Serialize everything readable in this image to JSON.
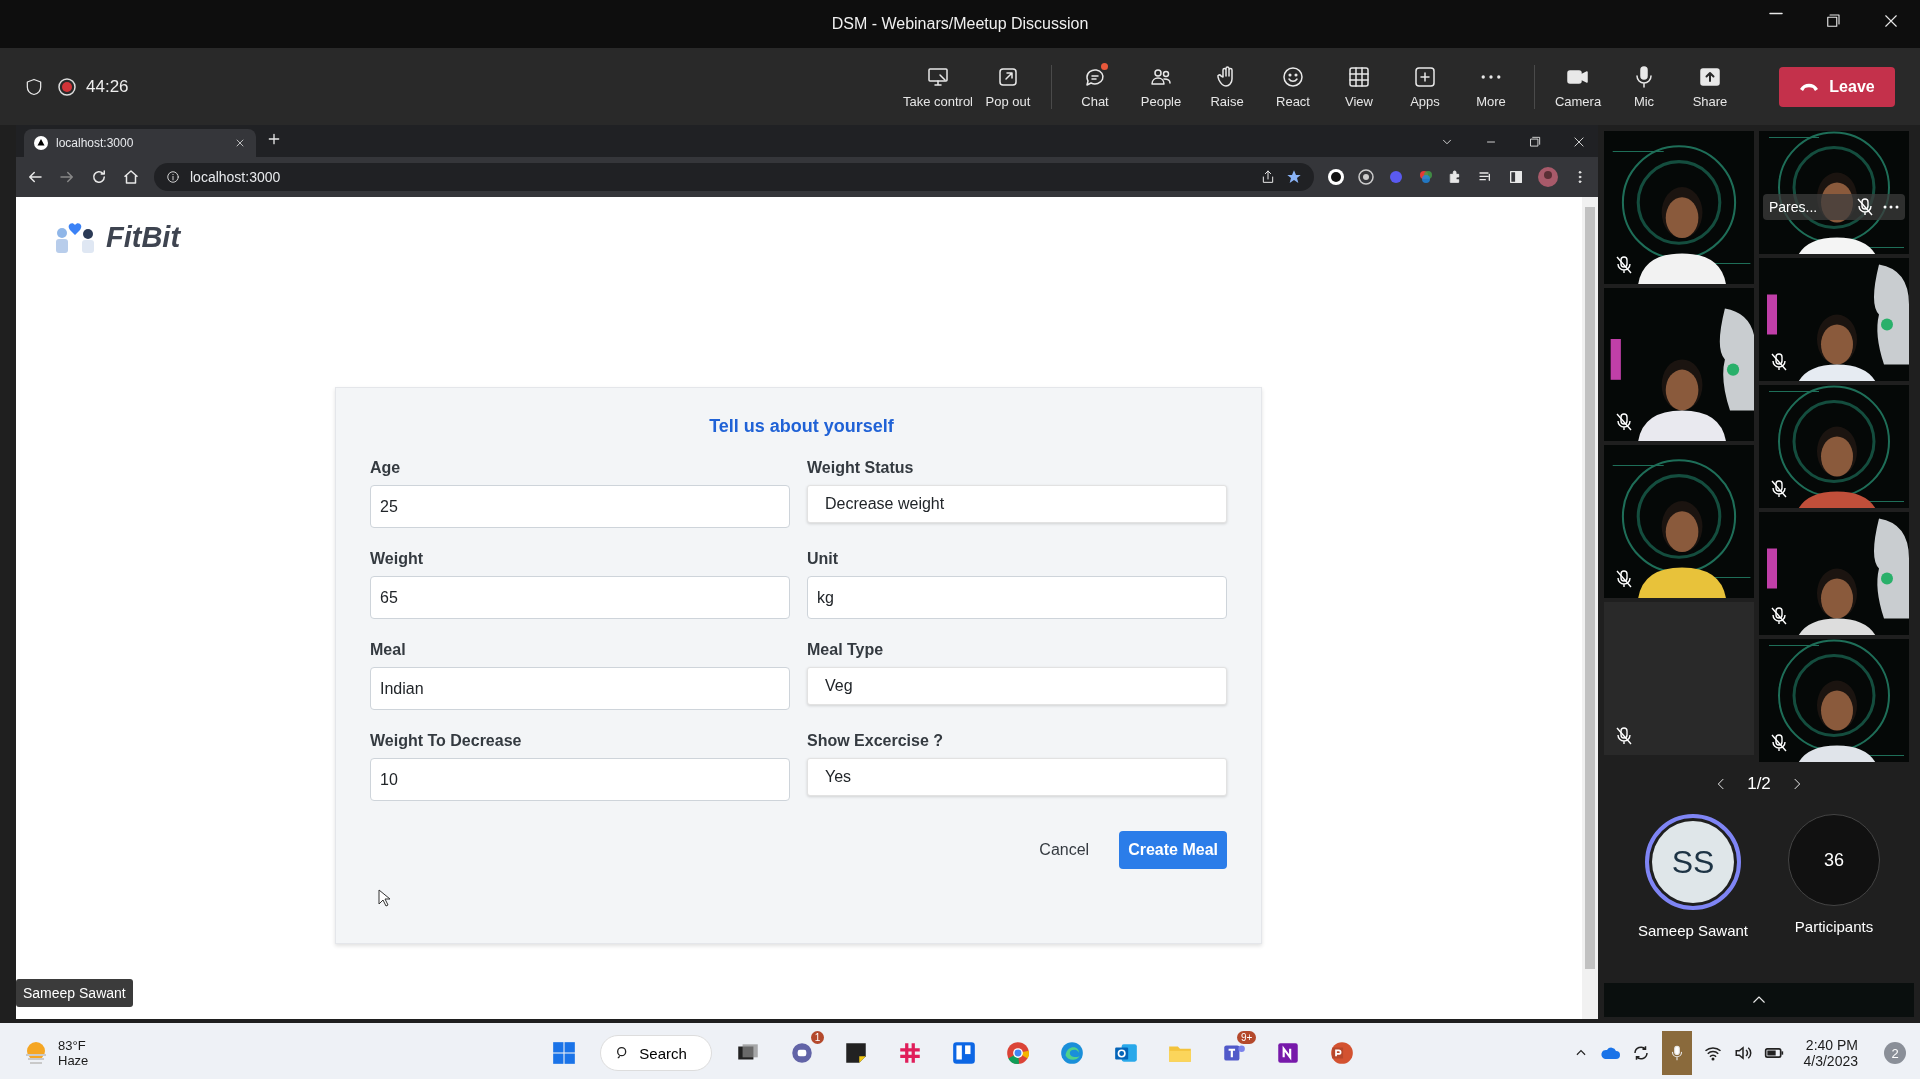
{
  "window": {
    "title": "DSM - Webinars/Meetup Discussion"
  },
  "meeting_bar": {
    "recording": true,
    "timer": "44:26",
    "actions": [
      {
        "label": "Take control",
        "unread": false
      },
      {
        "label": "Pop out",
        "unread": false
      },
      {
        "label": "Chat",
        "unread": true
      },
      {
        "label": "People",
        "unread": false
      },
      {
        "label": "Raise",
        "unread": false
      },
      {
        "label": "React",
        "unread": false
      },
      {
        "label": "View",
        "unread": false
      },
      {
        "label": "Apps",
        "unread": false
      },
      {
        "label": "More",
        "unread": false
      },
      {
        "label": "Camera",
        "unread": false
      },
      {
        "label": "Mic",
        "unread": false
      },
      {
        "label": "Share",
        "unread": false
      }
    ],
    "leave": "Leave"
  },
  "browser": {
    "tab": "localhost:3000",
    "url": "localhost:3000"
  },
  "page": {
    "logo": "FitBit",
    "form": {
      "title": "Tell us about yourself",
      "fields": [
        {
          "label": "Age",
          "value": "25",
          "kind": "input"
        },
        {
          "label": "Weight Status",
          "value": "Decrease weight",
          "kind": "select"
        },
        {
          "label": "Weight",
          "value": "65",
          "kind": "input"
        },
        {
          "label": "Unit",
          "value": "kg",
          "kind": "input"
        },
        {
          "label": "Meal",
          "value": "Indian",
          "kind": "input"
        },
        {
          "label": "Meal Type",
          "value": "Veg",
          "kind": "select"
        },
        {
          "label": "Weight To Decrease",
          "value": "10",
          "kind": "input"
        },
        {
          "label": "Show Excercise ?",
          "value": "Yes",
          "kind": "select"
        }
      ],
      "cancel": "Cancel",
      "submit": "Create Meal"
    }
  },
  "presenter_label": "Sameep Sawant",
  "video_columns": [
    {
      "tiles": [
        {
          "kind": "picture",
          "muted": true
        },
        {
          "kind": "picture",
          "muted": true
        },
        {
          "kind": "picture",
          "muted": true
        },
        {
          "kind": "empty",
          "muted": true
        }
      ]
    },
    {
      "tiles": [
        {
          "kind": "picture",
          "muted": true,
          "name": "Pares..."
        },
        {
          "kind": "picture",
          "muted": true
        },
        {
          "kind": "picture",
          "muted": true
        },
        {
          "kind": "picture",
          "muted": true
        },
        {
          "kind": "picture",
          "muted": true
        }
      ]
    }
  ],
  "pager": "1/2",
  "presenter": {
    "initials": "SS",
    "name": "Sameep Sawant"
  },
  "participants": {
    "count": "36",
    "label": "Participants"
  },
  "taskbar": {
    "weather": {
      "temperature": "83°F",
      "condition": "Haze"
    },
    "search": "Search",
    "badges": [
      "1",
      "9+"
    ],
    "time": "2:40 PM",
    "date": "4/3/2023",
    "notifications": "2"
  }
}
